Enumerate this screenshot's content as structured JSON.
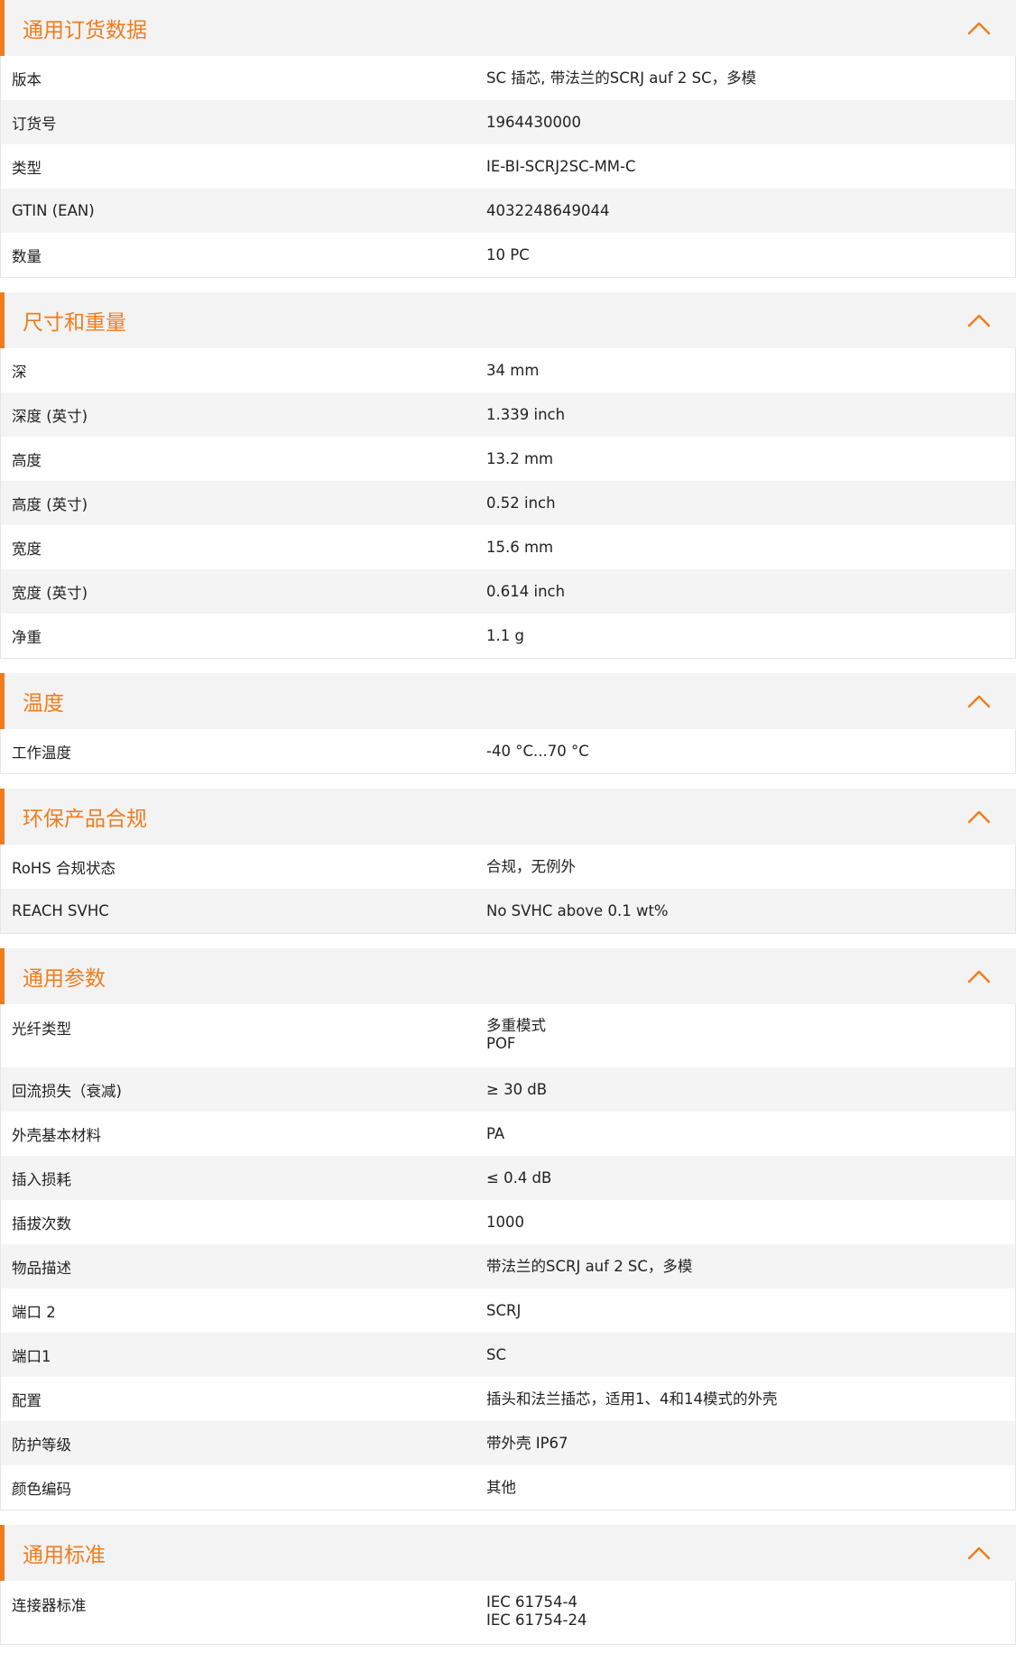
{
  "accent_color": "#f07c1c",
  "chevron_icon": "chevron-up-icon",
  "sections": [
    {
      "title": "通用订货数据",
      "rows": [
        {
          "label": "版本",
          "values": [
            "SC 插芯, 带法兰的SCRJ auf 2 SC，多模"
          ]
        },
        {
          "label": "订货号",
          "values": [
            "1964430000"
          ]
        },
        {
          "label": "类型",
          "values": [
            "IE-BI-SCRJ2SC-MM-C"
          ]
        },
        {
          "label": "GTIN (EAN)",
          "values": [
            "4032248649044"
          ]
        },
        {
          "label": "数量",
          "values": [
            "10  PC"
          ]
        }
      ]
    },
    {
      "title": "尺寸和重量",
      "rows": [
        {
          "label": "深",
          "values": [
            "34  mm"
          ]
        },
        {
          "label": "深度 (英寸)",
          "values": [
            "1.339  inch"
          ]
        },
        {
          "label": "高度",
          "values": [
            "13.2  mm"
          ]
        },
        {
          "label": "高度 (英寸)",
          "values": [
            "0.52  inch"
          ]
        },
        {
          "label": "宽度",
          "values": [
            "15.6  mm"
          ]
        },
        {
          "label": "宽度 (英寸)",
          "values": [
            "0.614  inch"
          ]
        },
        {
          "label": "净重",
          "values": [
            "1.1  g"
          ]
        }
      ]
    },
    {
      "title": "温度",
      "rows": [
        {
          "label": "工作温度",
          "values": [
            "-40 °C...70 °C"
          ]
        }
      ]
    },
    {
      "title": "环保产品合规",
      "rows": [
        {
          "label": "RoHS 合规状态",
          "values": [
            "合规，无例外"
          ]
        },
        {
          "label": "REACH SVHC",
          "values": [
            "No SVHC above 0.1 wt%"
          ]
        }
      ]
    },
    {
      "title": "通用参数",
      "rows": [
        {
          "label": "光纤类型",
          "values": [
            "多重模式",
            "POF"
          ]
        },
        {
          "label": "回流损失（衰减)",
          "values": [
            "≥ 30 dB"
          ]
        },
        {
          "label": "外壳基本材料",
          "values": [
            "PA"
          ]
        },
        {
          "label": "插入损耗",
          "values": [
            "≤ 0.4 dB"
          ]
        },
        {
          "label": "插拔次数",
          "values": [
            "1000"
          ]
        },
        {
          "label": "物品描述",
          "values": [
            "带法兰的SCRJ auf 2 SC，多模"
          ]
        },
        {
          "label": "端口 2",
          "values": [
            "SCRJ"
          ]
        },
        {
          "label": "端口1",
          "values": [
            "SC"
          ]
        },
        {
          "label": "配置",
          "values": [
            "插头和法兰插芯，适用1、4和14模式的外壳"
          ]
        },
        {
          "label": "防护等级",
          "values": [
            "带外壳 IP67"
          ]
        },
        {
          "label": "颜色编码",
          "values": [
            "其他"
          ]
        }
      ]
    },
    {
      "title": "通用标准",
      "rows": [
        {
          "label": "连接器标准",
          "values": [
            "IEC 61754-4",
            "IEC 61754-24"
          ]
        }
      ]
    }
  ]
}
